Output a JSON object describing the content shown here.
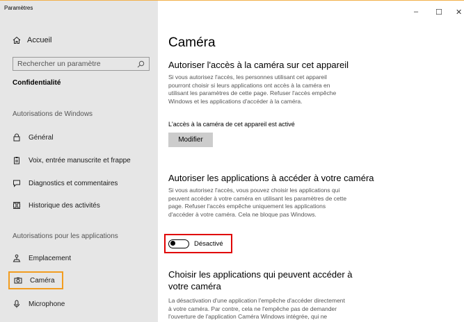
{
  "window": {
    "title": "Paramètres",
    "controls": {
      "minimize": "–",
      "maximize": "☐",
      "close": "✕"
    }
  },
  "sidebar": {
    "home": "Accueil",
    "search_placeholder": "Rechercher un paramètre",
    "section": "Confidentialité",
    "groups": [
      {
        "header": "Autorisations de Windows",
        "items": [
          {
            "label": "Général",
            "icon": "lock-icon"
          },
          {
            "label": "Voix, entrée manuscrite et frappe",
            "icon": "clipboard-icon"
          },
          {
            "label": "Diagnostics et commentaires",
            "icon": "feedback-icon"
          },
          {
            "label": "Historique des activités",
            "icon": "timeline-icon"
          }
        ]
      },
      {
        "header": "Autorisations pour les applications",
        "items": [
          {
            "label": "Emplacement",
            "icon": "location-icon"
          },
          {
            "label": "Caméra",
            "icon": "camera-icon",
            "selected": true
          },
          {
            "label": "Microphone",
            "icon": "microphone-icon"
          }
        ]
      }
    ]
  },
  "main": {
    "title": "Caméra",
    "section1": {
      "heading": "Autoriser l'accès à la caméra sur cet appareil",
      "lines": [
        "Si vous autorisez l'accès, les personnes utilisant cet appareil",
        "pourront choisir si leurs applications ont accès à la caméra en",
        "utilisant les paramètres de cette page. Refuser l'accès empêche",
        "Windows et les applications d'accéder à la caméra."
      ],
      "status": "L'accès à la caméra de cet appareil est activé",
      "button": "Modifier"
    },
    "section2": {
      "heading": "Autoriser les applications à accéder à votre caméra",
      "lines": [
        "Si vous autorisez l'accès, vous pouvez choisir les applications qui",
        "peuvent accéder à votre caméra en utilisant les paramètres de cette",
        "page. Refuser l'accès empêche uniquement les applications",
        "d'accéder à votre caméra. Cela ne bloque pas Windows."
      ],
      "toggle_label": "Désactivé",
      "toggle_on": false
    },
    "section3": {
      "heading_line1": "Choisir les applications qui peuvent accéder à",
      "heading_line2": "votre caméra",
      "lines": [
        "La désactivation d'une application l'empêche d'accéder directement",
        "à votre caméra. Par contre, cela ne l'empêche pas de demander",
        "l'ouverture de l'application Caméra Windows intégrée, qui ne"
      ]
    }
  },
  "colors": {
    "highlight_selected": "#f29c1f",
    "highlight_toggle": "#e00000",
    "sidebar_bg": "#e6e6e6"
  }
}
